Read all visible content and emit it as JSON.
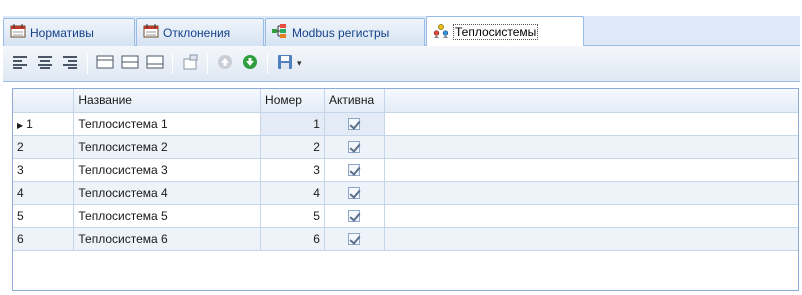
{
  "tabs": [
    {
      "label": "Нормативы",
      "icon": "calendar-icon"
    },
    {
      "label": "Отклонения",
      "icon": "calendar-icon"
    },
    {
      "label": "Modbus регистры",
      "icon": "network-icon"
    },
    {
      "label": "Теплосистемы",
      "icon": "people-icon",
      "active": true
    }
  ],
  "toolbar": {
    "buttons": [
      "align-left-icon",
      "align-center-icon",
      "align-right-icon",
      "layout-1-icon",
      "layout-2-icon",
      "layout-3-icon",
      "new-window-icon",
      "up-icon",
      "down-icon",
      "save-icon"
    ]
  },
  "grid": {
    "columns": {
      "index": "",
      "name": "Название",
      "number": "Номер",
      "active": "Активна"
    },
    "rows": [
      {
        "index": "1",
        "name": "Теплосистема 1",
        "number": "1",
        "active": true,
        "current": true
      },
      {
        "index": "2",
        "name": "Теплосистема 2",
        "number": "2",
        "active": true
      },
      {
        "index": "3",
        "name": "Теплосистема 3",
        "number": "3",
        "active": true
      },
      {
        "index": "4",
        "name": "Теплосистема 4",
        "number": "4",
        "active": true
      },
      {
        "index": "5",
        "name": "Теплосистема 5",
        "number": "5",
        "active": true
      },
      {
        "index": "6",
        "name": "Теплосистема 6",
        "number": "6",
        "active": true
      }
    ]
  },
  "colors": {
    "accent": "#99bbe8",
    "header_bg": "#e3ecf7",
    "row_alt": "#eef3fa"
  }
}
